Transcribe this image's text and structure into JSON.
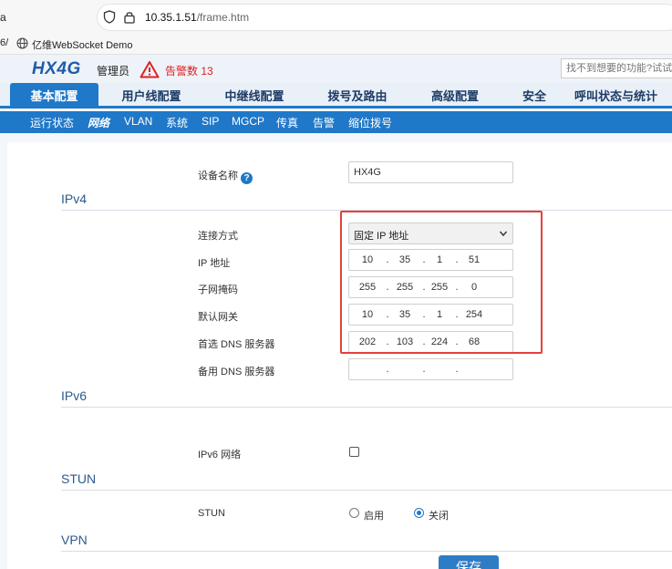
{
  "browser": {
    "prev_tab_fragment": "a",
    "url_host": "10.35.1.51",
    "url_path": "/frame.htm",
    "bookmark_fragment": "6/",
    "bookmark_label": "亿维WebSocket Demo"
  },
  "header": {
    "logo": "HX4G",
    "role": "管理员",
    "alarm_label": "告警数 13",
    "search_placeholder": "找不到想要的功能?试试"
  },
  "main_nav": {
    "tabs": [
      {
        "label": "基本配置",
        "active": true
      },
      {
        "label": "用户线配置"
      },
      {
        "label": "中继线配置"
      },
      {
        "label": "拨号及路由"
      },
      {
        "label": "高级配置"
      },
      {
        "label": "安全"
      },
      {
        "label": "呼叫状态与统计"
      }
    ]
  },
  "sub_nav": {
    "items": [
      {
        "label": "运行状态"
      },
      {
        "label": "网络",
        "active": true
      },
      {
        "label": "VLAN"
      },
      {
        "label": "系统"
      },
      {
        "label": "SIP"
      },
      {
        "label": "MGCP"
      },
      {
        "label": "传真"
      },
      {
        "label": "告警"
      },
      {
        "label": "缩位拨号"
      }
    ]
  },
  "form": {
    "device_name": {
      "label": "设备名称",
      "value": "HX4G"
    },
    "ipv4": {
      "title": "IPv4",
      "connection_type": {
        "label": "连接方式",
        "value": "固定 IP 地址"
      },
      "ip_address": {
        "label": "IP 地址",
        "octets": [
          "10",
          "35",
          "1",
          "51"
        ]
      },
      "subnet_mask": {
        "label": "子网掩码",
        "octets": [
          "255",
          "255",
          "255",
          "0"
        ]
      },
      "gateway": {
        "label": "默认网关",
        "octets": [
          "10",
          "35",
          "1",
          "254"
        ]
      },
      "primary_dns": {
        "label": "首选 DNS 服务器",
        "octets": [
          "202",
          "103",
          "224",
          "68"
        ]
      },
      "secondary_dns": {
        "label": "备用 DNS 服务器",
        "octets": [
          "",
          "",
          "",
          ""
        ]
      }
    },
    "ipv6": {
      "title": "IPv6",
      "network": {
        "label": "IPv6 网络",
        "checked": false
      }
    },
    "stun": {
      "title": "STUN",
      "label": "STUN",
      "enable_label": "启用",
      "disable_label": "关闭",
      "selected": "disable"
    },
    "vpn": {
      "title": "VPN"
    },
    "save_label": "保存"
  },
  "colors": {
    "primary_blue": "#1f78c8",
    "highlight_red": "#e5403a",
    "alarm_red": "#e02020",
    "logo_blue": "#1d5ba8"
  }
}
